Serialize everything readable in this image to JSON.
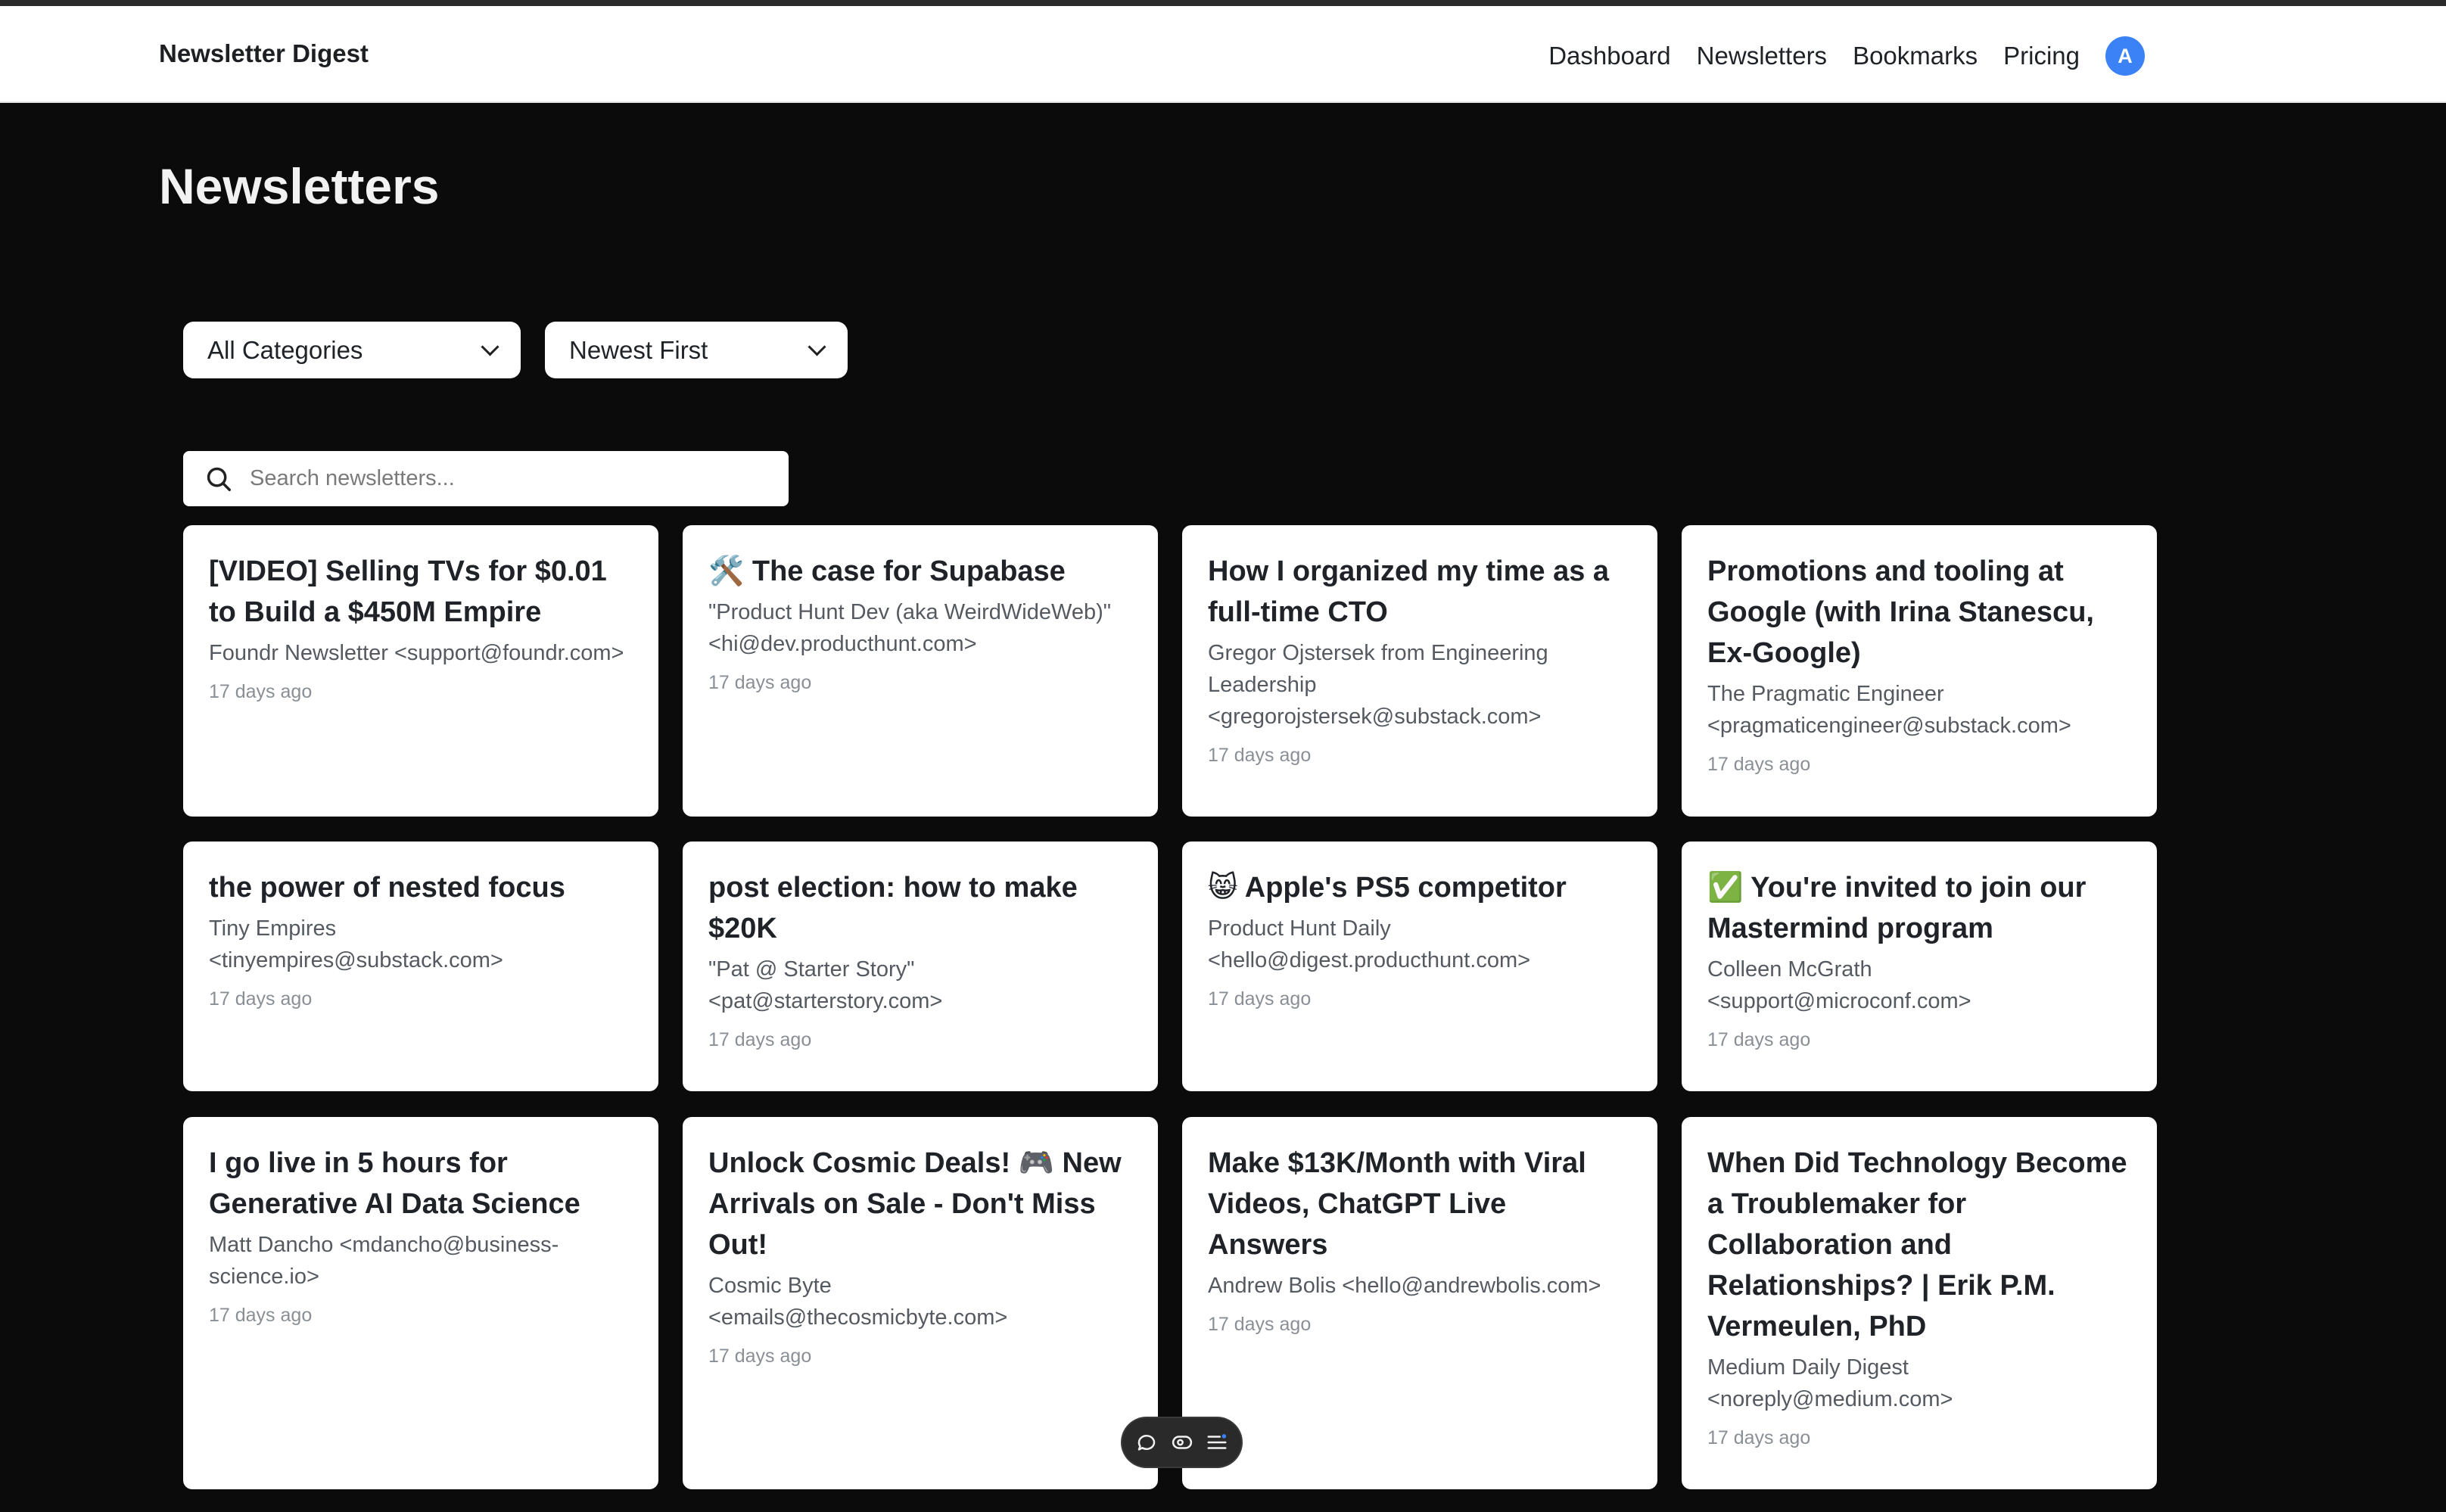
{
  "nav": {
    "brand": "Newsletter Digest",
    "links": [
      "Dashboard",
      "Newsletters",
      "Bookmarks",
      "Pricing"
    ],
    "avatar_initial": "A",
    "avatar_color": "#3b82f6"
  },
  "page": {
    "title": "Newsletters"
  },
  "filters": {
    "category_selected": "All Categories",
    "sort_selected": "Newest First"
  },
  "search": {
    "placeholder": "Search newsletters..."
  },
  "cards": [
    {
      "title": "[VIDEO] Selling TVs for $0.01 to Build a $450M Empire",
      "sender": "Foundr Newsletter <support@foundr.com>",
      "date": "17 days ago"
    },
    {
      "title": "🛠️ The case for Supabase",
      "sender": "\"Product Hunt Dev (aka WeirdWideWeb)\" <hi@dev.producthunt.com>",
      "date": "17 days ago"
    },
    {
      "title": "How I organized my time as a full-time CTO",
      "sender": "Gregor Ojstersek from Engineering Leadership <gregorojstersek@substack.com>",
      "date": "17 days ago"
    },
    {
      "title": "Promotions and tooling at Google (with Irina Stanescu, Ex-Google)",
      "sender": "The Pragmatic Engineer <pragmaticengineer@substack.com>",
      "date": "17 days ago"
    },
    {
      "title": "the power of nested focus",
      "sender": "Tiny Empires <tinyempires@substack.com>",
      "date": "17 days ago"
    },
    {
      "title": "post election: how to make $20K",
      "sender": "\"Pat @ Starter Story\" <pat@starterstory.com>",
      "date": "17 days ago"
    },
    {
      "title": "😸 Apple's PS5 competitor",
      "sender": "Product Hunt Daily <hello@digest.producthunt.com>",
      "date": "17 days ago"
    },
    {
      "title": "✅ You're invited to join our Mastermind program",
      "sender": "Colleen McGrath <support@microconf.com>",
      "date": "17 days ago"
    },
    {
      "title": "I go live in 5 hours for Generative AI Data Science",
      "sender": "Matt Dancho <mdancho@business-science.io>",
      "date": "17 days ago"
    },
    {
      "title": "Unlock Cosmic Deals! 🎮 New Arrivals on Sale - Don't Miss Out!",
      "sender": "Cosmic Byte <emails@thecosmicbyte.com>",
      "date": "17 days ago"
    },
    {
      "title": "Make $13K/Month with Viral Videos, ChatGPT Live Answers",
      "sender": "Andrew Bolis <hello@andrewbolis.com>",
      "date": "17 days ago"
    },
    {
      "title": "When Did Technology Become a Troublemaker for Collaboration and Relationships? | Erik P.M. Vermeulen, PhD",
      "sender": "Medium Daily Digest <noreply@medium.com>",
      "date": "17 days ago"
    }
  ],
  "toolbar": {
    "icons": [
      "comment-icon",
      "eye-icon",
      "menu-list-icon"
    ]
  },
  "colors": {
    "page_bg": "#0b0b0b",
    "card_bg": "#ffffff",
    "accent": "#3b82f6"
  }
}
